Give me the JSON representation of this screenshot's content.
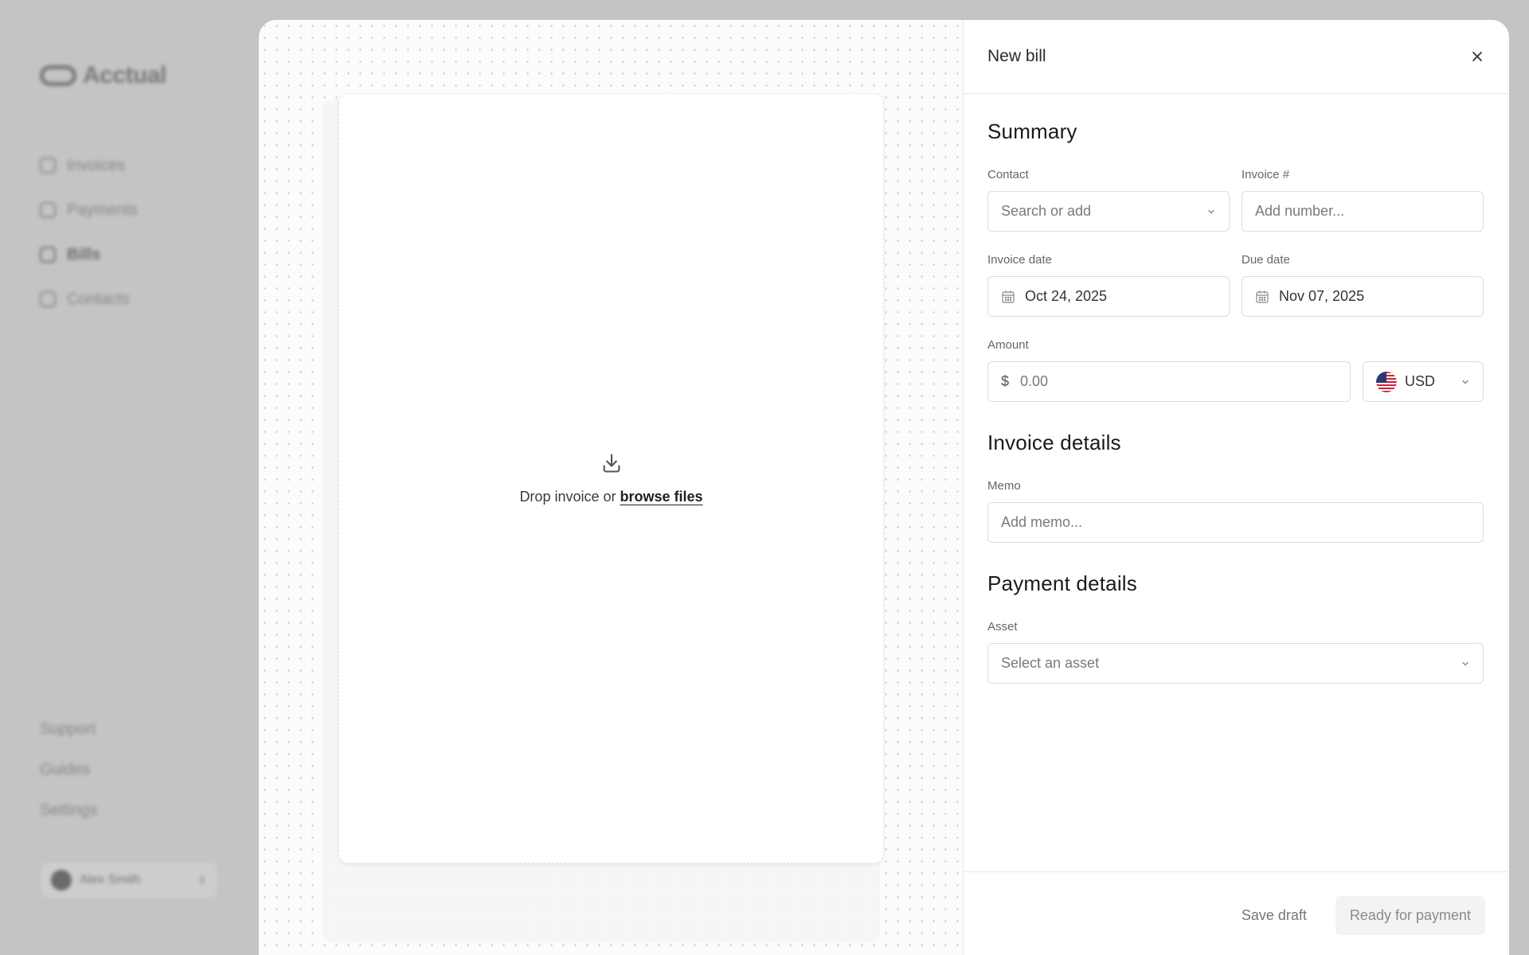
{
  "background_app": {
    "brand": "Acctual",
    "nav": [
      {
        "label": "Invoices",
        "icon": "invoice-icon"
      },
      {
        "label": "Payments",
        "icon": "chart-icon"
      },
      {
        "label": "Bills",
        "icon": "bill-icon",
        "active": true
      },
      {
        "label": "Contacts",
        "icon": "contacts-icon"
      }
    ],
    "bottom_links": [
      "Support",
      "Guides",
      "Settings"
    ],
    "user": {
      "name": "Alex Smith"
    }
  },
  "dropzone": {
    "text": "Drop invoice or ",
    "link": "browse files",
    "icon": "download-icon"
  },
  "form": {
    "title": "New bill",
    "close_icon": "close-icon",
    "summary": {
      "title": "Summary",
      "contact": {
        "label": "Contact",
        "placeholder": "Search or add"
      },
      "invoice_number": {
        "label": "Invoice #",
        "placeholder": "Add number..."
      },
      "invoice_date": {
        "label": "Invoice date",
        "value": "Oct 24, 2025"
      },
      "due_date": {
        "label": "Due date",
        "value": "Nov 07, 2025"
      },
      "amount": {
        "label": "Amount",
        "prefix": "$",
        "placeholder": "0.00"
      },
      "currency": {
        "value": "USD",
        "flag": "us-flag-icon"
      }
    },
    "invoice_details": {
      "title": "Invoice details",
      "memo": {
        "label": "Memo",
        "placeholder": "Add memo..."
      }
    },
    "payment_details": {
      "title": "Payment details",
      "asset": {
        "label": "Asset",
        "placeholder": "Select an asset"
      }
    },
    "footer": {
      "save_draft": "Save draft",
      "ready": "Ready for payment"
    }
  }
}
